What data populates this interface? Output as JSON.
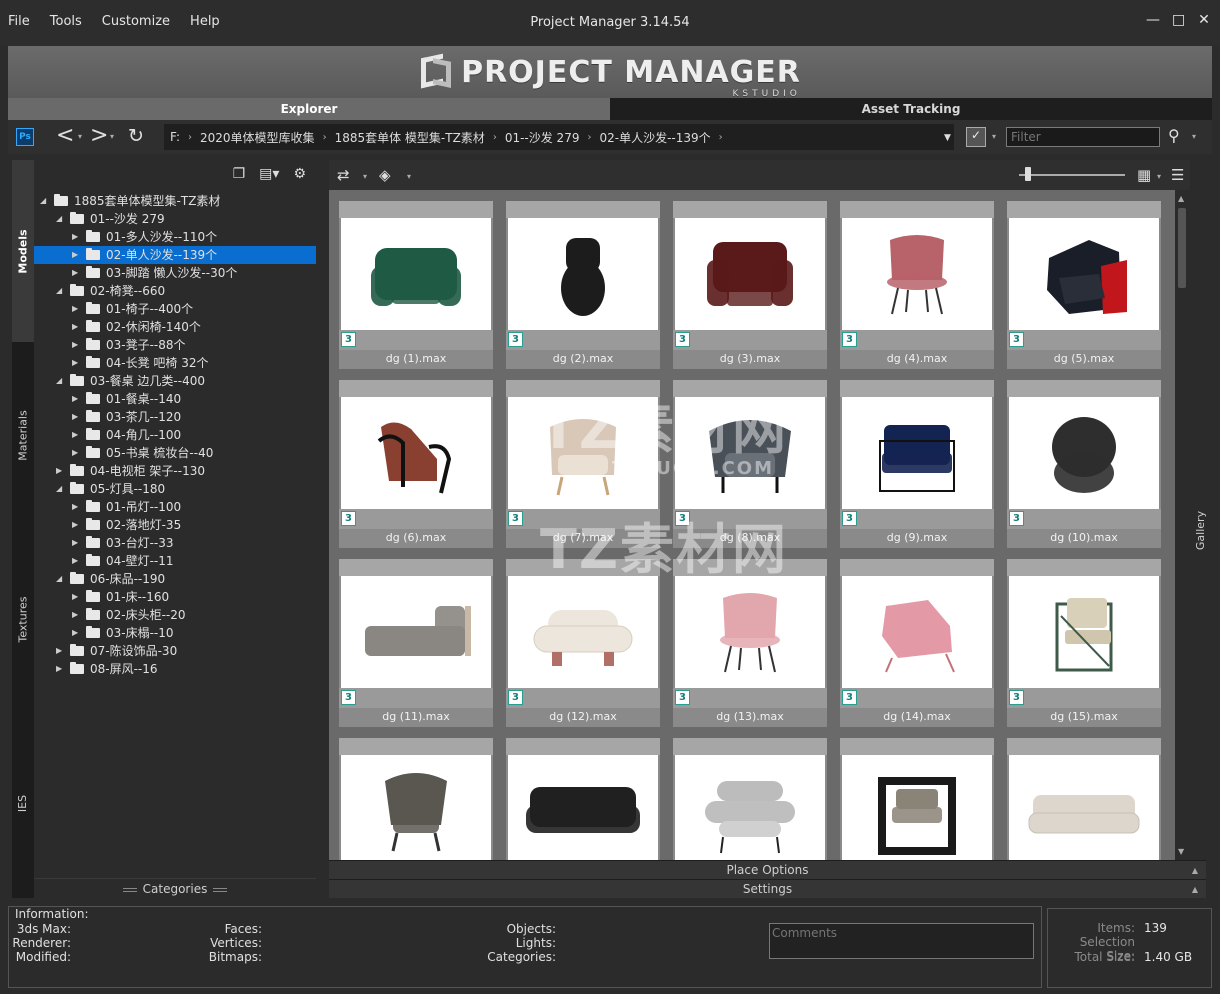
{
  "menu": [
    "File",
    "Tools",
    "Customize",
    "Help"
  ],
  "app_title": "Project Manager 3.14.54",
  "window_controls": {
    "minimize": "—",
    "maximize": "□",
    "close": "✕"
  },
  "banner": {
    "logo_text": "PROJECT MANAGER",
    "logo_sub": "KSTUDIO"
  },
  "tabs": {
    "explorer": "Explorer",
    "asset_tracking": "Asset Tracking"
  },
  "path": {
    "drive": "F:",
    "segments": [
      "2020单体模型库收集",
      "1885套单体 模型集-TZ素材",
      "01--沙发 279",
      "02-单人沙发--139个"
    ]
  },
  "filter": {
    "placeholder": "Filter"
  },
  "vtabs": {
    "models": "Models",
    "materials": "Materials",
    "textures": "Textures",
    "ies": "IES"
  },
  "tree": [
    {
      "label": "1885套单体模型集-TZ素材",
      "level": 0,
      "open": true
    },
    {
      "label": "01--沙发 279",
      "level": 1,
      "open": true
    },
    {
      "label": "01-多人沙发--110个",
      "level": 2,
      "open": false
    },
    {
      "label": "02-单人沙发--139个",
      "level": 2,
      "open": false,
      "selected": true
    },
    {
      "label": "03-脚踏 懒人沙发--30个",
      "level": 2,
      "open": false
    },
    {
      "label": "02-椅凳--660",
      "level": 1,
      "open": true
    },
    {
      "label": "01-椅子--400个",
      "level": 2,
      "open": false
    },
    {
      "label": "02-休闲椅-140个",
      "level": 2,
      "open": false
    },
    {
      "label": "03-凳子--88个",
      "level": 2,
      "open": false
    },
    {
      "label": "04-长凳 吧椅 32个",
      "level": 2,
      "open": false
    },
    {
      "label": "03-餐桌 边几类--400",
      "level": 1,
      "open": true
    },
    {
      "label": "01-餐桌--140",
      "level": 2,
      "open": false
    },
    {
      "label": "03-茶几--120",
      "level": 2,
      "open": false
    },
    {
      "label": "04-角几--100",
      "level": 2,
      "open": false
    },
    {
      "label": "05-书桌 梳妆台--40",
      "level": 2,
      "open": false
    },
    {
      "label": "04-电视柜 架子--130",
      "level": 1,
      "open": false
    },
    {
      "label": "05-灯具--180",
      "level": 1,
      "open": true
    },
    {
      "label": "01-吊灯--100",
      "level": 2,
      "open": false
    },
    {
      "label": "02-落地灯-35",
      "level": 2,
      "open": false
    },
    {
      "label": "03-台灯--33",
      "level": 2,
      "open": false
    },
    {
      "label": "04-壁灯--11",
      "level": 2,
      "open": false
    },
    {
      "label": "06-床品--190",
      "level": 1,
      "open": true
    },
    {
      "label": "01-床--160",
      "level": 2,
      "open": false
    },
    {
      "label": "02-床头柜--20",
      "level": 2,
      "open": false
    },
    {
      "label": "03-床榻--10",
      "level": 2,
      "open": false
    },
    {
      "label": "07-陈设饰品-30",
      "level": 1,
      "open": false
    },
    {
      "label": "08-屏风--16",
      "level": 1,
      "open": false
    }
  ],
  "categories_label": "Categories",
  "gallery": {
    "items": [
      {
        "name": "dg (1).max",
        "color": "#1f5a45",
        "shape": "armchair-box"
      },
      {
        "name": "dg (2).max",
        "color": "#1c1c1c",
        "shape": "tall-stool"
      },
      {
        "name": "dg (3).max",
        "color": "#5a1a1a",
        "shape": "club-chair"
      },
      {
        "name": "dg (4).max",
        "color": "#b8626a",
        "shape": "shell-chair"
      },
      {
        "name": "dg (5).max",
        "color": "#1a1e28",
        "shape": "angular-chair"
      },
      {
        "name": "dg (6).max",
        "color": "#8a4030",
        "shape": "lounge-frame"
      },
      {
        "name": "dg (7).max",
        "color": "#d9c8b8",
        "shape": "tub-chair"
      },
      {
        "name": "dg (8).max",
        "color": "#4a5058",
        "shape": "wing-club"
      },
      {
        "name": "dg (9).max",
        "color": "#142452",
        "shape": "velvet-frame"
      },
      {
        "name": "dg (10).max",
        "color": "#2e2e2e",
        "shape": "round-chair"
      },
      {
        "name": "dg (11).max",
        "color": "#8a8682",
        "shape": "chaise"
      },
      {
        "name": "dg (12).max",
        "color": "#ece6dc",
        "shape": "pill-chair"
      },
      {
        "name": "dg (13).max",
        "color": "#e2a7ad",
        "shape": "shell-chair"
      },
      {
        "name": "dg (14).max",
        "color": "#e49aa6",
        "shape": "lounge-pink"
      },
      {
        "name": "dg (15).max",
        "color": "#3e5a48",
        "shape": "wire-chair"
      },
      {
        "name": "",
        "color": "#5a5650",
        "shape": "wing-chair"
      },
      {
        "name": "",
        "color": "#202020",
        "shape": "loveseat"
      },
      {
        "name": "",
        "color": "#bcbcbc",
        "shape": "roll-chair"
      },
      {
        "name": "",
        "color": "#1a1a1a",
        "shape": "box-frame"
      },
      {
        "name": "",
        "color": "#ddd6cc",
        "shape": "daybed"
      }
    ]
  },
  "place_options": "Place Options",
  "settings": "Settings",
  "info": {
    "title": "Information:",
    "col1": [
      "3ds Max:",
      "Renderer:",
      "Modified:"
    ],
    "col2": [
      "Faces:",
      "Vertices:",
      "Bitmaps:"
    ],
    "col3": [
      "Objects:",
      "Lights:",
      "Categories:"
    ],
    "comments_placeholder": "Comments"
  },
  "stats": {
    "items_label": "Items:",
    "items_value": "139",
    "selection_label": "Selection Size:",
    "selection_value": "",
    "total_label": "Total Size:",
    "total_value": "1.40 GB"
  },
  "watermark": {
    "brand": "TZ素材网",
    "domain": "TZSUCAI.COM"
  }
}
